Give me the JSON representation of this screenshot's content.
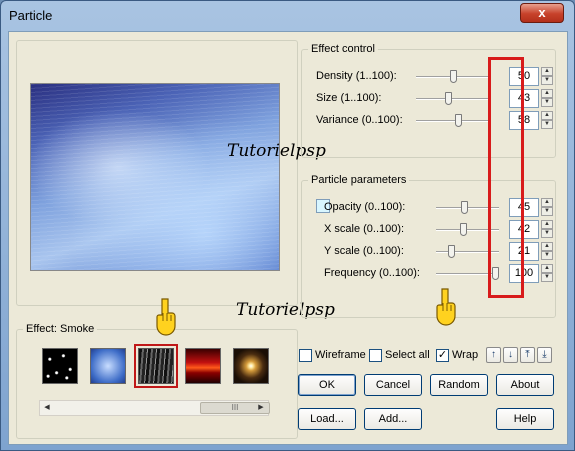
{
  "window": {
    "title": "Particle",
    "close_glyph": "x"
  },
  "watermarks": {
    "top": "Tutorielpsp",
    "bottom": "Tutorielpsp"
  },
  "effect_control": {
    "title": "Effect control",
    "rows": [
      {
        "label": "Density (1..100):",
        "value": "50",
        "level": 50
      },
      {
        "label": "Size (1..100):",
        "value": "43",
        "level": 43
      },
      {
        "label": "Variance (0..100):",
        "value": "58",
        "level": 58
      }
    ]
  },
  "particle_parameters": {
    "title": "Particle parameters",
    "rows": [
      {
        "label": "Opacity (0..100):",
        "value": "45",
        "level": 45
      },
      {
        "label": "X scale (0..100):",
        "value": "42",
        "level": 42
      },
      {
        "label": "Y scale (0..100):",
        "value": "21",
        "level": 21
      },
      {
        "label": "Frequency (0..100):",
        "value": "100",
        "level": 100
      }
    ],
    "opacity_color": "#d8f6ff"
  },
  "effects": {
    "title": "Effect: Smoke",
    "thumbnails": [
      "stars-thumb",
      "clouds-thumb",
      "smoke-thumb",
      "fire-thumb",
      "sparkle-thumb"
    ],
    "selected": "smoke-thumb",
    "scroll_grip": "III"
  },
  "options": {
    "wireframe": {
      "label": "Wireframe",
      "checked": false
    },
    "select_all": {
      "label": "Select all",
      "checked": false
    },
    "wrap": {
      "label": "Wrap",
      "checked": true
    }
  },
  "arrow_buttons": [
    "move-up-icon",
    "move-down-icon",
    "move-top-icon",
    "move-bottom-icon"
  ],
  "buttons": {
    "ok": "OK",
    "cancel": "Cancel",
    "random": "Random",
    "about": "About",
    "load": "Load...",
    "add": "Add...",
    "help": "Help"
  },
  "colors": {
    "highlight": "#d81b1b",
    "title_accent": "#c7412a"
  }
}
